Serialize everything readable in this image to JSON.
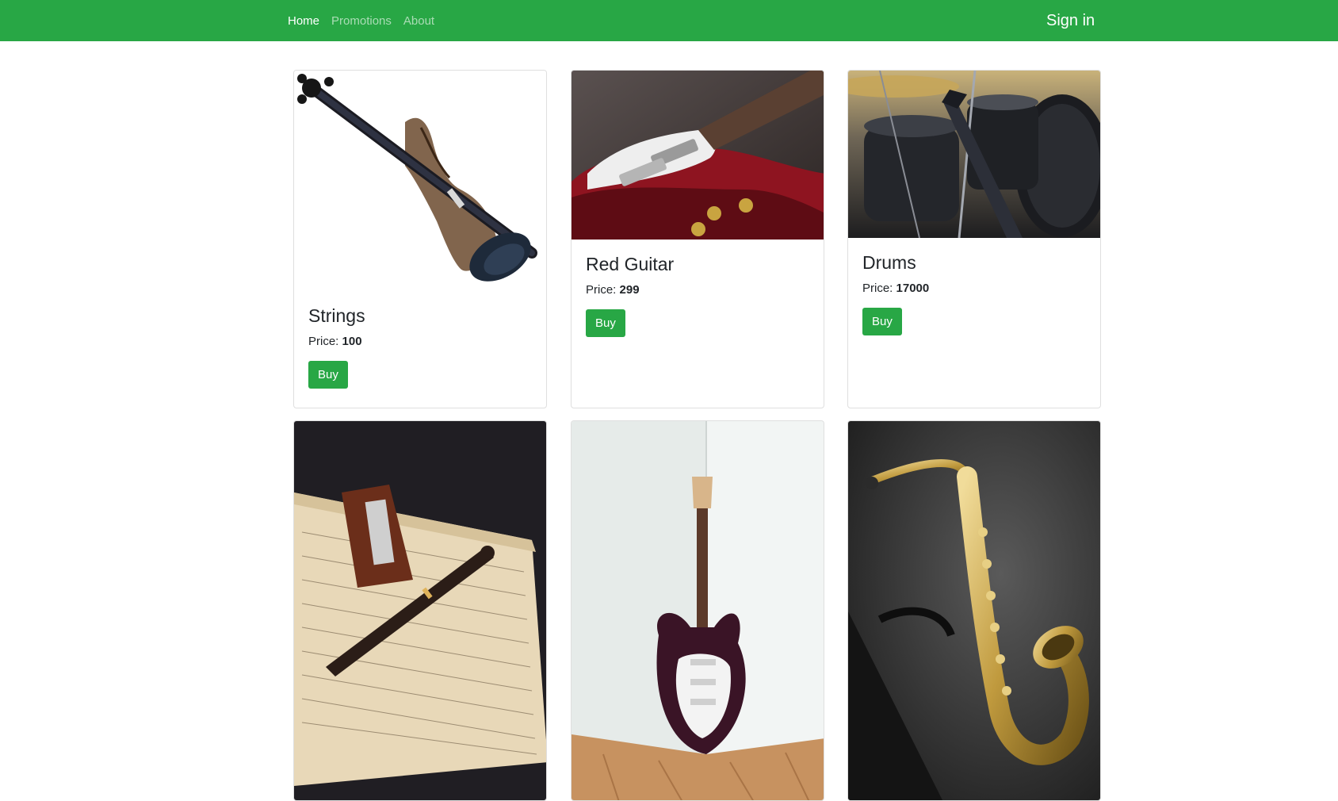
{
  "nav": {
    "links": [
      {
        "label": "Home"
      },
      {
        "label": "Promotions"
      },
      {
        "label": "About"
      }
    ],
    "signin_label": "Sign in"
  },
  "products": [
    {
      "title": "Strings",
      "price_label": "Price:",
      "price": "100",
      "buy_label": "Buy"
    },
    {
      "title": "Red Guitar",
      "price_label": "Price:",
      "price": "299",
      "buy_label": "Buy"
    },
    {
      "title": "Drums",
      "price_label": "Price:",
      "price": "17000",
      "buy_label": "Buy"
    }
  ],
  "colors": {
    "brand": "#28a745"
  }
}
